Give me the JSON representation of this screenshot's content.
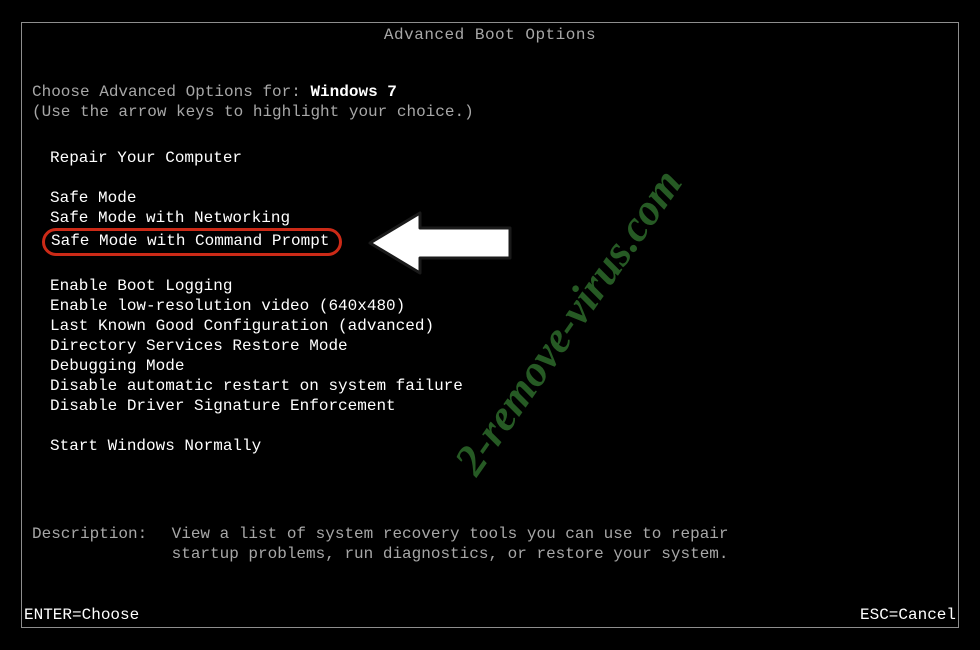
{
  "title": "Advanced Boot Options",
  "intro": {
    "line1a": "Choose Advanced Options for: ",
    "os": "Windows 7",
    "line2": "(Use the arrow keys to highlight your choice.)"
  },
  "menu": {
    "group1": [
      "Repair Your Computer"
    ],
    "group2": [
      "Safe Mode",
      "Safe Mode with Networking",
      "Safe Mode with Command Prompt"
    ],
    "group3": [
      "Enable Boot Logging",
      "Enable low-resolution video (640x480)",
      "Last Known Good Configuration (advanced)",
      "Directory Services Restore Mode",
      "Debugging Mode",
      "Disable automatic restart on system failure",
      "Disable Driver Signature Enforcement"
    ],
    "group4": [
      "Start Windows Normally"
    ],
    "highlighted_index": 2
  },
  "description": {
    "label": "Description:",
    "text": "View a list of system recovery tools you can use to repair startup problems, run diagnostics, or restore your system."
  },
  "footer": {
    "left": "ENTER=Choose",
    "right": "ESC=Cancel"
  },
  "watermark": "2-remove-virus.com",
  "colors": {
    "highlight_border": "#cc2a17",
    "text_dim": "#a7a7a7",
    "text_bright": "#ffffff",
    "watermark": "#2d6a2a"
  }
}
